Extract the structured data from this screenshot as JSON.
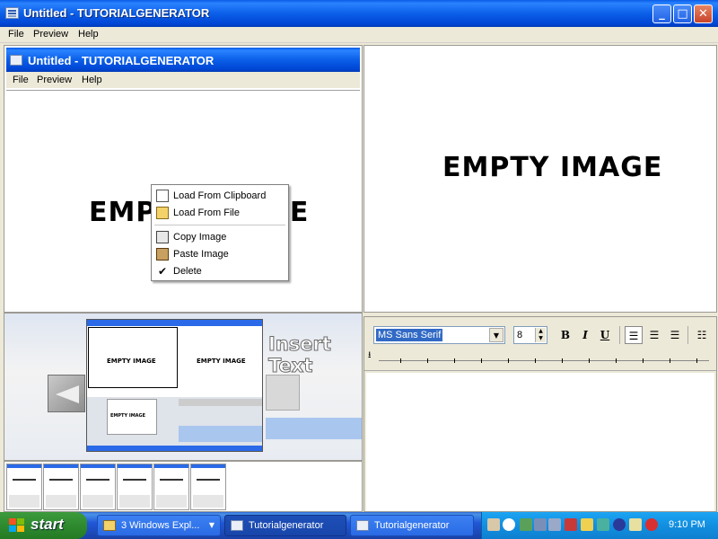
{
  "window": {
    "title": "Untitled - TUTORIALGENERATOR"
  },
  "menu": {
    "file": "File",
    "preview": "Preview",
    "help": "Help"
  },
  "inner_window": {
    "title": "Untitled - TUTORIALGENERATOR",
    "menu": {
      "file": "File",
      "preview": "Preview",
      "help": "Help"
    }
  },
  "left_preview": {
    "placeholder": "EMPTY IMAGE"
  },
  "right_preview": {
    "placeholder": "EMPTY IMAGE"
  },
  "context_menu": {
    "items": [
      {
        "label": "Load From Clipboard",
        "icon": "document-icon"
      },
      {
        "label": "Load From File",
        "icon": "folder-open-icon"
      },
      {
        "label": "Copy Image",
        "icon": "copy-icon"
      },
      {
        "label": "Paste Image",
        "icon": "paste-icon"
      },
      {
        "label": "Delete",
        "icon": "check-icon"
      }
    ]
  },
  "thumbnail_area": {
    "insert_text_label": "Insert Text",
    "mini_empty_left": "EMPTY IMAGE",
    "mini_empty_right": "EMPTY IMAGE",
    "mini_empty_small": "EMPTY IMAGE"
  },
  "editor": {
    "font": "MS Sans Serif",
    "size": "8",
    "bold": "B",
    "italic": "I",
    "underline": "U"
  },
  "taskbar": {
    "start": "start",
    "buttons": [
      {
        "label": "3 Windows Expl...",
        "active": false
      },
      {
        "label": "Tutorialgenerator",
        "active": true
      },
      {
        "label": "Tutorialgenerator",
        "active": false
      }
    ],
    "clock": "9:10 PM"
  },
  "colors": {
    "xp_blue": "#0b5fe8",
    "start_green": "#2f8a2f",
    "tray_blue": "#128fe0",
    "highlight": "#316ac5"
  }
}
